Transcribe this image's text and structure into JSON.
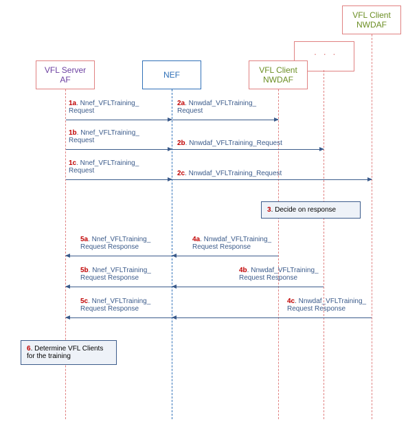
{
  "actors": {
    "vfl_server_af": "VFL Server\nAF",
    "nef": "NEF",
    "vfl_client_nwdaf_1": "VFL Client\nNWDAF",
    "vfl_client_nwdaf_2": "VFL Client\nNWDAF"
  },
  "messages": {
    "m1a": {
      "num": "1a",
      "text": ". Nnef_VFLTraining_\nRequest"
    },
    "m2a": {
      "num": "2a",
      "text": ". Nnwdaf_VFLTraining_\nRequest"
    },
    "m1b": {
      "num": "1b",
      "text": ". Nnef_VFLTraining_\nRequest"
    },
    "m2b": {
      "num": "2b",
      "text": ". Nnwdaf_VFLTraining_Request"
    },
    "m1c": {
      "num": "1c",
      "text": ". Nnef_VFLTraining_\nRequest"
    },
    "m2c": {
      "num": "2c",
      "text": ". Nnwdaf_VFLTraining_Request"
    },
    "m4a": {
      "num": "4a",
      "text": ". Nnwdaf_VFLTraining_\nRequest Response"
    },
    "m5a": {
      "num": "5a",
      "text": ". Nnef_VFLTraining_\nRequest Response"
    },
    "m4b": {
      "num": "4b",
      "text": ". Nnwdaf_VFLTraining_\nRequest Response"
    },
    "m5b": {
      "num": "5b",
      "text": ". Nnef_VFLTraining_\nRequest Response"
    },
    "m4c": {
      "num": "4c",
      "text": ". Nnwdaf_VFLTraining_\nRequest Response"
    },
    "m5c": {
      "num": "5c",
      "text": ". Nnef_VFLTraining_\nRequest Response"
    }
  },
  "notes": {
    "n3": {
      "num": "3",
      "text": ". Decide on response"
    },
    "n6": {
      "num": "6",
      "text": ". Determine VFL Clients\nfor the training"
    }
  },
  "colors": {
    "purple": "#6b3fa0",
    "blue": "#2e6fb7",
    "red": "#e08080",
    "olive": "#6b8e23",
    "arrow": "#3a5a8a"
  },
  "chart_data": {
    "type": "table",
    "description": "Sequence diagram: VFL Server AF interacts with NEF which forwards to multiple VFL Client NWDAF instances",
    "participants": [
      "VFL Server AF",
      "NEF",
      "VFL Client NWDAF",
      "...",
      "VFL Client NWDAF (N)"
    ],
    "steps": [
      {
        "step": "1a",
        "from": "VFL Server AF",
        "to": "NEF",
        "message": "Nnef_VFLTraining_Request"
      },
      {
        "step": "2a",
        "from": "NEF",
        "to": "VFL Client NWDAF 1",
        "message": "Nnwdaf_VFLTraining_Request"
      },
      {
        "step": "1b",
        "from": "VFL Server AF",
        "to": "NEF",
        "message": "Nnef_VFLTraining_Request"
      },
      {
        "step": "2b",
        "from": "NEF",
        "to": "VFL Client NWDAF ...",
        "message": "Nnwdaf_VFLTraining_Request"
      },
      {
        "step": "1c",
        "from": "VFL Server AF",
        "to": "NEF",
        "message": "Nnef_VFLTraining_Request"
      },
      {
        "step": "2c",
        "from": "NEF",
        "to": "VFL Client NWDAF N",
        "message": "Nnwdaf_VFLTraining_Request"
      },
      {
        "step": "3",
        "actor": "VFL Client NWDAF(s)",
        "action": "Decide on response"
      },
      {
        "step": "4a",
        "from": "VFL Client NWDAF 1",
        "to": "NEF",
        "message": "Nnwdaf_VFLTraining_Request Response"
      },
      {
        "step": "5a",
        "from": "NEF",
        "to": "VFL Server AF",
        "message": "Nnef_VFLTraining_Request Response"
      },
      {
        "step": "4b",
        "from": "VFL Client NWDAF ...",
        "to": "NEF",
        "message": "Nnwdaf_VFLTraining_Request Response"
      },
      {
        "step": "5b",
        "from": "NEF",
        "to": "VFL Server AF",
        "message": "Nnef_VFLTraining_Request Response"
      },
      {
        "step": "4c",
        "from": "VFL Client NWDAF N",
        "to": "NEF",
        "message": "Nnwdaf_VFLTraining_Request Response"
      },
      {
        "step": "5c",
        "from": "NEF",
        "to": "VFL Server AF",
        "message": "Nnef_VFLTraining_Request Response"
      },
      {
        "step": "6",
        "actor": "VFL Server AF",
        "action": "Determine VFL Clients for the training"
      }
    ]
  }
}
